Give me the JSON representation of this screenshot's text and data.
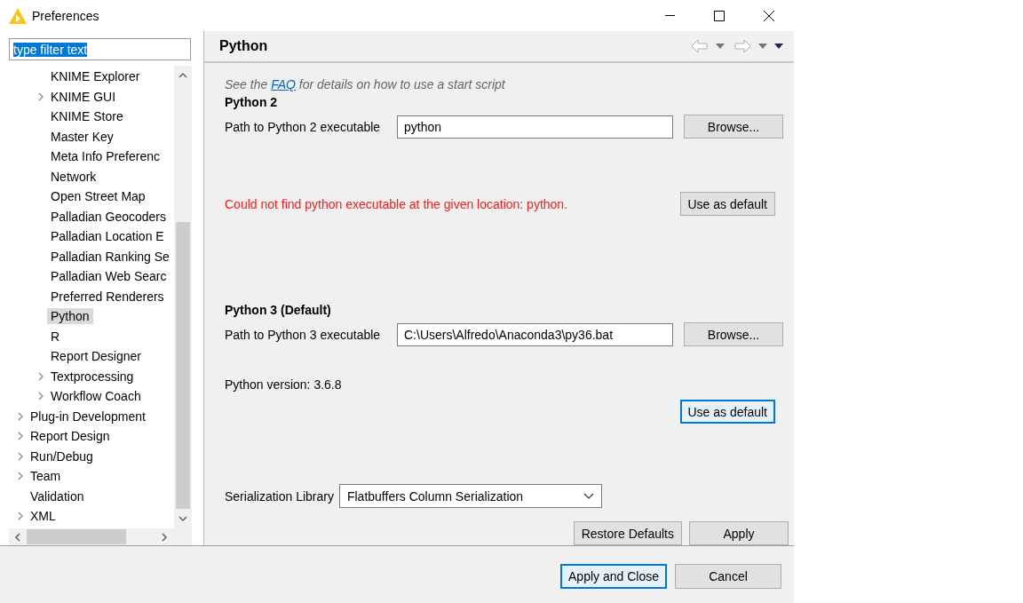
{
  "window": {
    "title": "Preferences"
  },
  "filter": {
    "value": "type filter text",
    "text_selected": true
  },
  "tree": {
    "items": [
      {
        "children": [
          {
            "label": "KNIME Explorer",
            "selected": false
          },
          {
            "label": "KNIME GUI",
            "selected": false,
            "expanded": false
          },
          {
            "label": "KNIME Store",
            "selected": false
          },
          {
            "label": "Master Key",
            "selected": false
          },
          {
            "label": "Meta Info Preferenc",
            "selected": false
          },
          {
            "label": "Network",
            "selected": false
          },
          {
            "label": "Open Street Map",
            "selected": false
          },
          {
            "label": "Palladian Geocoders",
            "selected": false
          },
          {
            "label": "Palladian Location E",
            "selected": false
          },
          {
            "label": "Palladian Ranking Se",
            "selected": false
          },
          {
            "label": "Palladian Web Searc",
            "selected": false
          },
          {
            "label": "Preferred Renderers",
            "selected": false
          },
          {
            "label": "Python",
            "selected": true
          },
          {
            "label": "R",
            "selected": false
          },
          {
            "label": "Report Designer",
            "selected": false
          },
          {
            "label": "Textprocessing",
            "selected": false,
            "expanded": false
          },
          {
            "label": "Workflow Coach",
            "selected": false,
            "expanded": false
          }
        ]
      },
      {
        "label": "Plug-in Development",
        "selected": false,
        "expanded": false
      },
      {
        "label": "Report Design",
        "selected": false,
        "expanded": false
      },
      {
        "label": "Run/Debug",
        "selected": false,
        "expanded": false
      },
      {
        "label": "Team",
        "selected": false,
        "expanded": false
      },
      {
        "label": "Validation",
        "selected": false
      },
      {
        "label": "XML",
        "selected": false,
        "expanded": false
      }
    ]
  },
  "page": {
    "title": "Python",
    "note_before": "See the",
    "note_link": "FAQ",
    "note_after": "for details on how to use a start script"
  },
  "sections": [
    {
      "heading": "Python 2",
      "label": "Path to Python 2 executable",
      "value": "python",
      "browse": "Browse...",
      "message": "Could not find python executable at the given location: python.",
      "error": true,
      "default_button": {
        "label": "Use as default",
        "focused": false
      }
    },
    {
      "heading": "Python 3 (Default)",
      "label": "Path to Python 3 executable",
      "value": "C:\\Users\\Alfredo\\Anaconda3\\py36.bat",
      "browse": "Browse...",
      "message": "Python version: 3.6.8",
      "error": false,
      "default_button": {
        "label": "Use as default",
        "focused": true
      }
    }
  ],
  "serialization": {
    "label": "Serialization Library",
    "value": "Flatbuffers Column Serialization"
  },
  "page_buttons": [
    "Restore Defaults",
    "Apply"
  ],
  "dialog_buttons": [
    {
      "label": "Apply and Close",
      "default": true
    },
    {
      "label": "Cancel",
      "default": false
    }
  ]
}
